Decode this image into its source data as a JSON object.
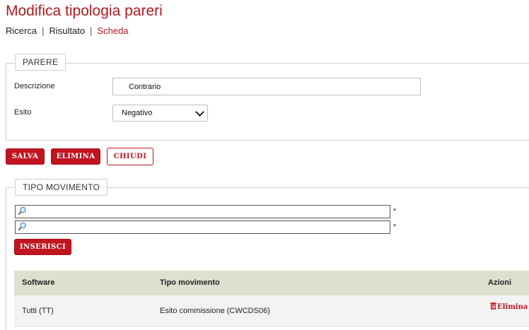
{
  "page": {
    "title": "Modifica tipologia pareri"
  },
  "breadcrumb": {
    "items": [
      "Ricerca",
      "Risultato",
      "Scheda"
    ],
    "separator": "|"
  },
  "parere": {
    "legend": "PARERE",
    "descrizione_label": "Descrizione",
    "descrizione_value": "Contrario",
    "esito_label": "Esito",
    "esito_value": "Negativo"
  },
  "actions": {
    "salva": "SALVA",
    "elimina": "ELIMINA",
    "chiudi": "CHIUDI"
  },
  "tipo_movimento": {
    "legend": "TIPO MOVIMENTO",
    "required_marker": "*",
    "inserisci": "INSERISCI",
    "table": {
      "headers": [
        "Software",
        "Tipo movimento",
        "Azioni"
      ],
      "rows": [
        {
          "software": "Tutti (TT)",
          "tipo_movimento": "Esito commissione (CWCDS06)",
          "action": "Elimina"
        }
      ]
    }
  },
  "colors": {
    "accent": "#c1141f",
    "table_header_bg": "#dfdfcf"
  }
}
